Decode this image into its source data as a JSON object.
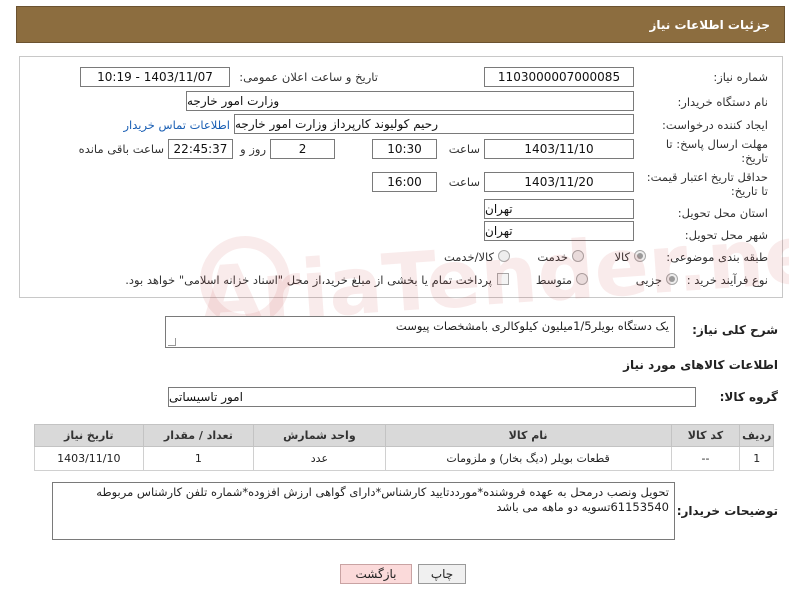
{
  "header": {
    "title": "جزئیات اطلاعات نیاز"
  },
  "form": {
    "need_number_label": "شماره نیاز:",
    "need_number": "1103000007000085",
    "announce_label": "تاریخ و ساعت اعلان عمومی:",
    "announce_value": "1403/11/07 - 10:19",
    "buyer_org_label": "نام دستگاه خریدار:",
    "buyer_org": "وزارت امور خارجه",
    "requester_label": "ایجاد کننده درخواست:",
    "requester": "رحیم کولیوند کارپرداز وزارت امور خارجه",
    "contact_link": "اطلاعات تماس خریدار",
    "reply_deadline_label": "مهلت ارسال پاسخ: تا تاریخ:",
    "reply_date": "1403/11/10",
    "time_label": "ساعت",
    "reply_time": "10:30",
    "days_value": "2",
    "days_label": "روز و",
    "remaining_value": "22:45:37",
    "remaining_label": "ساعت باقی مانده",
    "price_valid_label": "حداقل تاریخ اعتبار قیمت: تا تاریخ:",
    "price_valid_date": "1403/11/20",
    "price_valid_time": "16:00",
    "province_label": "استان محل تحویل:",
    "province": "تهران",
    "city_label": "شهر محل تحویل:",
    "city": "تهران",
    "category_label": "طبقه بندی موضوعی:",
    "category_options": [
      "کالا",
      "خدمت",
      "کالا/خدمت"
    ],
    "process_label": "نوع فرآیند خرید :",
    "process_options": [
      "جزیی",
      "متوسط"
    ],
    "payment_note": "پرداخت تمام یا بخشی از مبلغ خرید،از محل \"اسناد خزانه اسلامی\" خواهد بود."
  },
  "description": {
    "label": "شرح کلی نیاز:",
    "value": "یک دستگاه بویلر1/5میلیون کیلوکالری بامشخصات پیوست"
  },
  "goods_section": {
    "title": "اطلاعات کالاهای مورد نیاز"
  },
  "goods_group": {
    "label": "گروه کالا:",
    "value": "امور تاسیساتی"
  },
  "table": {
    "headers": [
      "ردیف",
      "کد کالا",
      "نام کالا",
      "واحد شمارش",
      "تعداد / مقدار",
      "تاریخ نیاز"
    ],
    "rows": [
      [
        "1",
        "--",
        "قطعات بویلر (دیگ بخار) و ملزومات",
        "عدد",
        "1",
        "1403/11/10"
      ]
    ]
  },
  "buyer_notes": {
    "label": "توضیحات خریدار:",
    "value": "تحویل ونصب درمحل به عهده فروشنده*مورددتایید کارشناس*دارای گواهی ارزش افزوده*شماره تلفن کارشناس مربوطه 61153540تسویه دو ماهه می باشد"
  },
  "buttons": {
    "print": "چاپ",
    "back": "بازگشت"
  },
  "watermark": {
    "text": "AriaTender.neT"
  }
}
